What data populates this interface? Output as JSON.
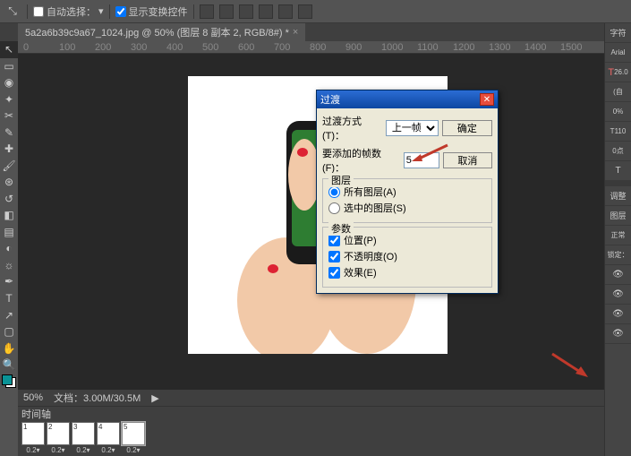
{
  "topbar": {
    "auto_select_label": "自动选择：",
    "show_transform_label": "显示变换控件",
    "dropdown_icon": "▾"
  },
  "tab": {
    "title": "5a2a6b39c9a67_1024.jpg @ 50% (图层 8 副本 2, RGB/8#) *",
    "close": "×"
  },
  "ruler": {
    "marks": [
      "0",
      "100",
      "200",
      "300",
      "400",
      "500",
      "600",
      "700",
      "800",
      "900",
      "1000",
      "1100",
      "1200",
      "1300",
      "1400",
      "1500"
    ]
  },
  "status": {
    "zoom": "50%",
    "doc": "文档：3.00M/30.5M",
    "arrow": "▶"
  },
  "timeline": {
    "header": "时间轴",
    "frames": [
      {
        "n": "1",
        "dur": "0.2▾"
      },
      {
        "n": "2",
        "dur": "0.2▾"
      },
      {
        "n": "3",
        "dur": "0.2▾"
      },
      {
        "n": "4",
        "dur": "0.2▾"
      },
      {
        "n": "5",
        "dur": "0.2▾"
      }
    ]
  },
  "dialog": {
    "title": "过渡",
    "method_label": "过渡方式(T)：",
    "method_value": "上一帧",
    "frames_label": "要添加的帧数(F)：",
    "frames_value": "5",
    "ok": "确定",
    "cancel": "取消",
    "layers_legend": "图层",
    "all_layers": "所有图层(A)",
    "sel_layers": "选中的图层(S)",
    "params_legend": "参数",
    "position": "位置(P)",
    "opacity": "不透明度(O)",
    "effects": "效果(E)"
  },
  "right": {
    "char": "字符",
    "font": "Arial",
    "size": "26.0",
    "leading": "(自",
    "tracking": "0%",
    "vh": "110",
    "pt": "0点",
    "T": "T",
    "adjust": "调整",
    "layers": "图层",
    "normal": "正常",
    "lock": "锁定："
  }
}
